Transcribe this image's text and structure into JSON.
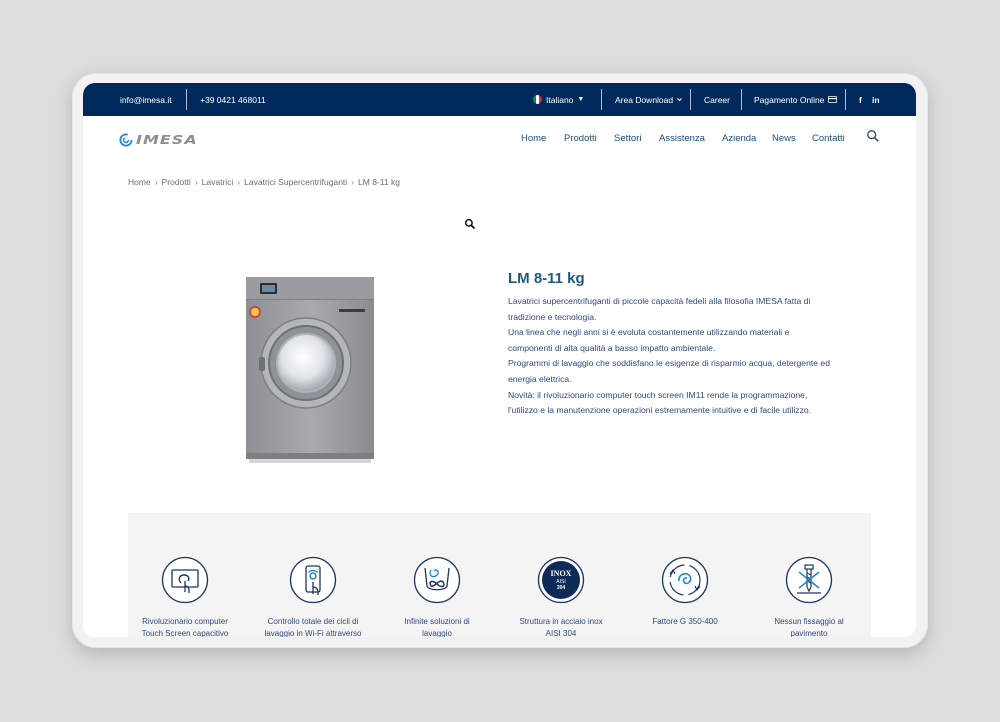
{
  "topbar": {
    "email": "info@imesa.it",
    "phone": "+39 0421 468011",
    "language": "Italiano",
    "download": "Area Download",
    "career": "Career",
    "payment": "Pagamento Online",
    "facebook": "f",
    "linkedin": "in"
  },
  "logo": {
    "text": "IMESA"
  },
  "nav": {
    "items": [
      "Home",
      "Prodotti",
      "Settori",
      "Assistenza",
      "Azienda",
      "News",
      "Contatti"
    ]
  },
  "breadcrumb": [
    "Home",
    "Prodotti",
    "Lavatrici",
    "Lavatrici Supercentrifuganti",
    "LM 8-11 kg"
  ],
  "product": {
    "title": "LM 8-11 kg",
    "description": [
      "Lavatrici supercentrifuganti di piccole capacità fedeli alla filosofia IMESA fatta di",
      "tradizione e tecnologia.",
      "Una linea che negli anni si è evoluta costantemente utilizzando materiali e",
      "componenti di alta qualità a basso impatto ambientale.",
      "Programmi di lavaggio che soddisfano le esigenze di risparmio acqua, detergente ed",
      "energia elettrica.",
      "Novità: il rivoluzionario computer touch screen IM11 rende la programmazione,",
      "l'utilizzo e la manutenzione operazioni estremamente intuitive e di facile utilizzo."
    ],
    "machine_brand": "IMESA"
  },
  "features": [
    {
      "line1": "Rivoluzionario computer",
      "line2": "Touch Screen capacitivo",
      "icon": "touch-screen-icon"
    },
    {
      "line1": "Controllo totale dei cicli di",
      "line2": "lavaggio in Wi-Fi attraverso",
      "icon": "wifi-phone-icon"
    },
    {
      "line1": "Infinite soluzioni di",
      "line2": "lavaggio",
      "icon": "infinite-wash-icon"
    },
    {
      "line1": "Struttura in acciaio inox",
      "line2": "AISI 304",
      "icon": "inox-badge-icon",
      "badge": [
        "INOX",
        "AISI",
        "304"
      ]
    },
    {
      "line1": "Fattore G 350-400",
      "line2": "",
      "icon": "g-factor-icon"
    },
    {
      "line1": "Nessun fissaggio al",
      "line2": "pavimento",
      "icon": "no-fixing-icon"
    }
  ],
  "colors": {
    "navy": "#002a5c",
    "nav_text": "#1a4d7e",
    "title": "#1d5c78",
    "accent": "#1b8ac9"
  }
}
